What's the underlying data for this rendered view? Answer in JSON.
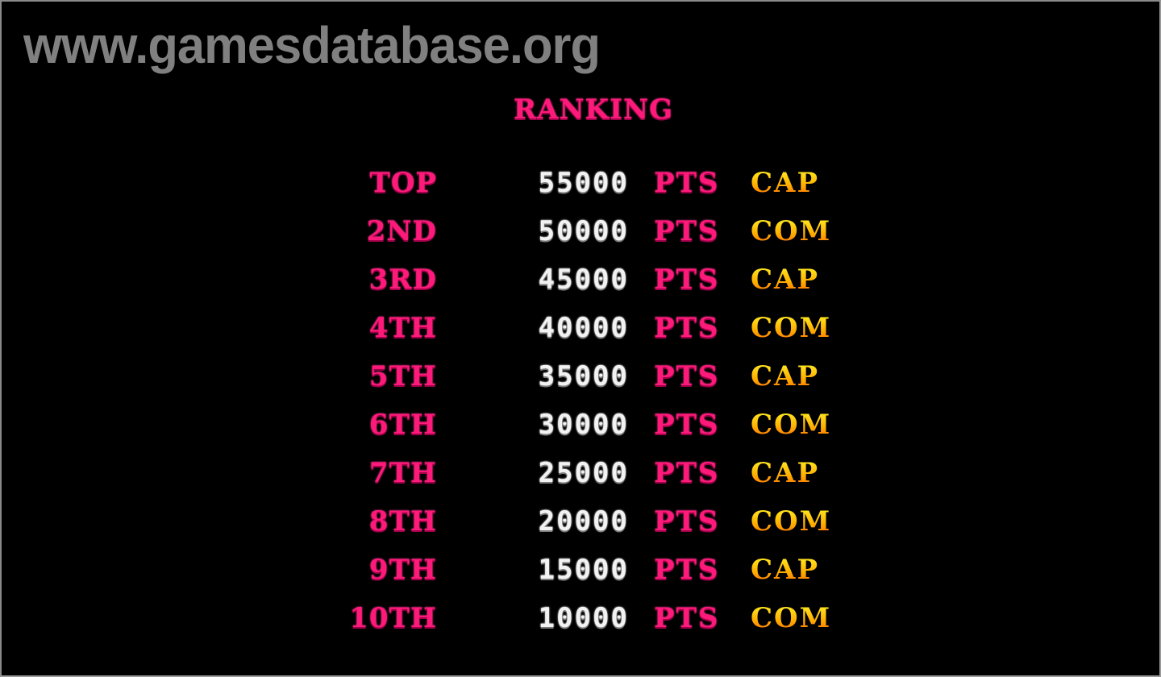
{
  "watermark": "www.gamesdatabase.org",
  "screen": {
    "title": "RANKING",
    "points_suffix": "PTS",
    "colors": {
      "background": "#000000",
      "rank_label": "#ff1a7a",
      "score": "#f2f2f2",
      "pts": "#ff1a7a",
      "name": "#ffcc00",
      "watermark": "#808080"
    },
    "rankings": [
      {
        "rank": "TOP",
        "score": "55000",
        "pts": "PTS",
        "name": "CAP"
      },
      {
        "rank": "2ND",
        "score": "50000",
        "pts": "PTS",
        "name": "COM"
      },
      {
        "rank": "3RD",
        "score": "45000",
        "pts": "PTS",
        "name": "CAP"
      },
      {
        "rank": "4TH",
        "score": "40000",
        "pts": "PTS",
        "name": "COM"
      },
      {
        "rank": "5TH",
        "score": "35000",
        "pts": "PTS",
        "name": "CAP"
      },
      {
        "rank": "6TH",
        "score": "30000",
        "pts": "PTS",
        "name": "COM"
      },
      {
        "rank": "7TH",
        "score": "25000",
        "pts": "PTS",
        "name": "CAP"
      },
      {
        "rank": "8TH",
        "score": "20000",
        "pts": "PTS",
        "name": "COM"
      },
      {
        "rank": "9TH",
        "score": "15000",
        "pts": "PTS",
        "name": "CAP"
      },
      {
        "rank": "10TH",
        "score": "10000",
        "pts": "PTS",
        "name": "COM"
      }
    ]
  }
}
